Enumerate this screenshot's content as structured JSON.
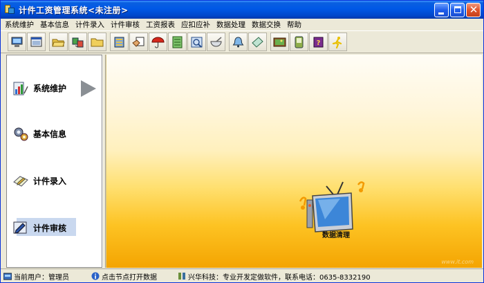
{
  "window": {
    "title": "计件工资管理系统<未注册>"
  },
  "menu": {
    "items": [
      "系统维护",
      "基本信息",
      "计件录入",
      "计件审核",
      "工资报表",
      "应扣应补",
      "数据处理",
      "数据交换",
      "帮助"
    ]
  },
  "toolbar": {
    "buttons": [
      "monitor-icon",
      "window-icon",
      "folder-open-icon",
      "transfer-icon",
      "folder-icon",
      "database-icon",
      "hand-note-icon",
      "umbrella-icon",
      "notebook-icon",
      "report-icon",
      "bowl-icon",
      "bell-icon",
      "paper-icon",
      "picture-icon",
      "pda-icon",
      "help-book-icon",
      "exit-runner-icon"
    ]
  },
  "nav": {
    "items": [
      {
        "label": "系统维护",
        "icon": "building-chart-icon"
      },
      {
        "label": "基本信息",
        "icon": "gears-icon"
      },
      {
        "label": "计件录入",
        "icon": "pencil-paper-icon"
      },
      {
        "label": "计件审核",
        "icon": "edit-check-icon"
      }
    ]
  },
  "main": {
    "tv_label": "数据清理",
    "watermark": "www.it.com"
  },
  "status": {
    "user": "当前用户：管理员",
    "hint": "点击节点打开数据",
    "company": "兴华科技：专业开发定做软件，联系电话：0635-8332190"
  },
  "colors": {
    "titlebar": "#0058e6",
    "content_top": "#fffdf6",
    "content_bottom": "#f4a401"
  }
}
